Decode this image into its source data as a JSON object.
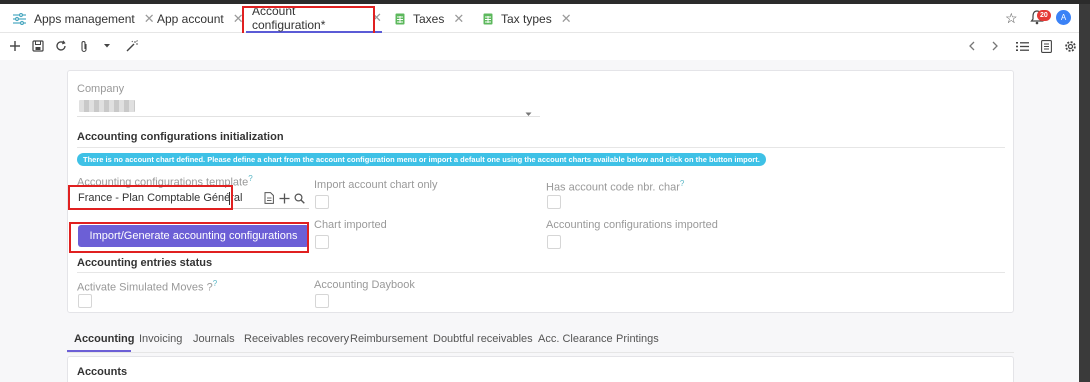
{
  "tabs": [
    {
      "label": "Apps management",
      "icon": "sliders-icon"
    },
    {
      "label": "App account",
      "icon": ""
    },
    {
      "label": "Account configuration*",
      "icon": "",
      "active": true
    },
    {
      "label": "Taxes",
      "icon": "sheet-icon"
    },
    {
      "label": "Tax types",
      "icon": "sheet-icon"
    }
  ],
  "header": {
    "notifications_count": "20",
    "avatar_letter": "A"
  },
  "form": {
    "company_label": "Company",
    "company_value": "",
    "section_init_title": "Accounting configurations initialization",
    "info_message": "There is no account chart defined. Please define a chart from the account configuration menu or import a default one using the account charts available below and click on the button import.",
    "template_label": "Accounting configurations template",
    "template_value": "France - Plan Comptable Général",
    "import_only_label": "Import account chart only",
    "has_code_label": "Has account code nbr. char",
    "chart_imported_label": "Chart imported",
    "configs_imported_label": "Accounting configurations imported",
    "import_button_label": "Import/Generate accounting configurations",
    "section_entries_title": "Accounting entries status",
    "simulated_label": "Activate Simulated Moves ?",
    "daybook_label": "Accounting Daybook",
    "help_mark": "?"
  },
  "bottom_tabs": [
    "Accounting",
    "Invoicing",
    "Journals",
    "Receivables recovery",
    "Reimbursement",
    "Doubtful receivables",
    "Acc. Clearance",
    "Printings"
  ],
  "accounts_title": "Accounts",
  "colors": {
    "accent": "#6c5fd6",
    "info": "#3ec1e6",
    "badge": "#e53935",
    "highlight": "#e02020"
  }
}
